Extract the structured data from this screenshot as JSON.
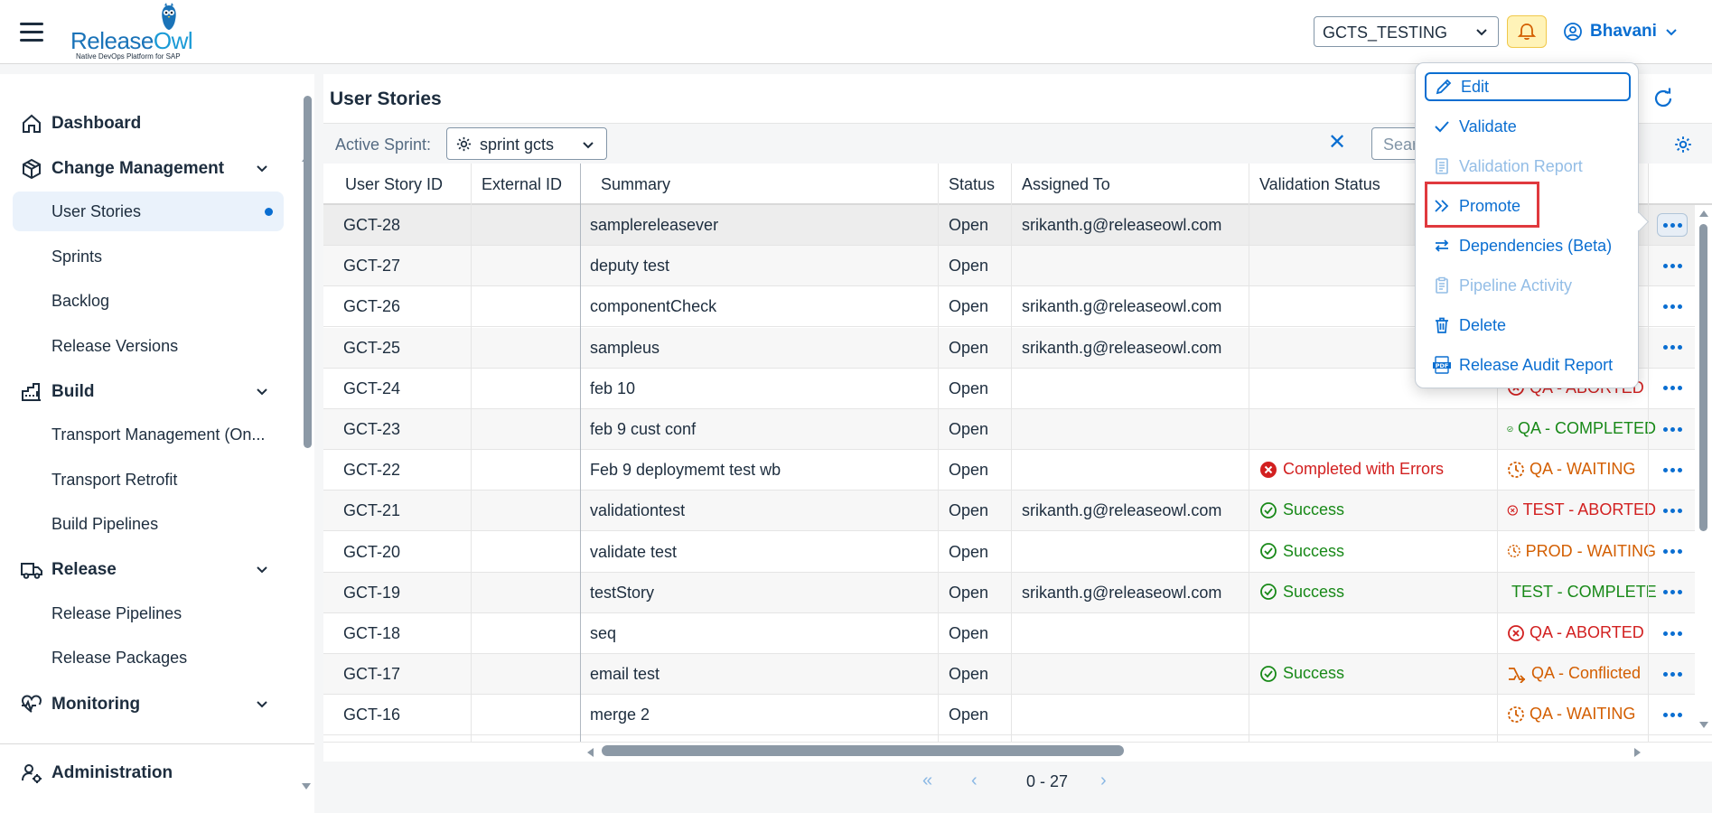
{
  "header": {
    "logo_main": "Release",
    "logo_accent": "Owl",
    "logo_sub": "Native DevOps Platform for SAP",
    "system_select": "GCTS_TESTING",
    "user_name": "Bhavani"
  },
  "sidebar": {
    "groups": [
      {
        "label": "Dashboard",
        "icon": "home-icon"
      },
      {
        "label": "Change Management",
        "icon": "box-icon"
      },
      {
        "label": "Build",
        "icon": "factory-icon"
      },
      {
        "label": "Release",
        "icon": "truck-icon"
      },
      {
        "label": "Monitoring",
        "icon": "heart-pulse-icon"
      },
      {
        "label": "Administration",
        "icon": "user-settings-icon"
      }
    ],
    "items": [
      {
        "label": "User Stories"
      },
      {
        "label": "Sprints"
      },
      {
        "label": "Backlog"
      },
      {
        "label": "Release Versions"
      },
      {
        "label": "Transport Management (On..."
      },
      {
        "label": "Transport Retrofit"
      },
      {
        "label": "Build Pipelines"
      },
      {
        "label": "Release Pipelines"
      },
      {
        "label": "Release Packages"
      }
    ]
  },
  "main": {
    "title": "User Stories",
    "sprint_label": "Active Sprint:",
    "sprint_value": "sprint gcts",
    "search_placeholder": "Search",
    "clear_symbol": "✕",
    "columns": [
      "User Story ID",
      "External ID",
      "Summary",
      "Status",
      "Assigned To",
      "Validation Status"
    ],
    "rows": [
      {
        "id": "GCT-28",
        "ext": "",
        "summary": "samplereleasever",
        "status": "Open",
        "assigned": "srikanth.g@releaseowl.com",
        "validation": "",
        "validation_type": "",
        "pipeline": "",
        "pipeline_type": ""
      },
      {
        "id": "GCT-27",
        "ext": "",
        "summary": "deputy test",
        "status": "Open",
        "assigned": "",
        "validation": "",
        "validation_type": "",
        "pipeline": "",
        "pipeline_type": ""
      },
      {
        "id": "GCT-26",
        "ext": "",
        "summary": "componentCheck",
        "status": "Open",
        "assigned": "srikanth.g@releaseowl.com",
        "validation": "",
        "validation_type": "",
        "pipeline": "",
        "pipeline_type": ""
      },
      {
        "id": "GCT-25",
        "ext": "",
        "summary": "sampleus",
        "status": "Open",
        "assigned": "srikanth.g@releaseowl.com",
        "validation": "",
        "validation_type": "",
        "pipeline": "",
        "pipeline_type": ""
      },
      {
        "id": "GCT-24",
        "ext": "",
        "summary": "feb 10",
        "status": "Open",
        "assigned": "",
        "validation": "",
        "validation_type": "",
        "pipeline": "QA - ABORTED",
        "pipeline_type": "aborted"
      },
      {
        "id": "GCT-23",
        "ext": "",
        "summary": "feb 9 cust conf",
        "status": "Open",
        "assigned": "",
        "validation": "",
        "validation_type": "",
        "pipeline": "QA - COMPLETED",
        "pipeline_type": "completed"
      },
      {
        "id": "GCT-22",
        "ext": "",
        "summary": "Feb 9 deploymemt test wb",
        "status": "Open",
        "assigned": "",
        "validation": "Completed with Errors",
        "validation_type": "error",
        "pipeline": "QA - WAITING",
        "pipeline_type": "waiting"
      },
      {
        "id": "GCT-21",
        "ext": "",
        "summary": "validationtest",
        "status": "Open",
        "assigned": "srikanth.g@releaseowl.com",
        "validation": "Success",
        "validation_type": "success",
        "pipeline": "TEST - ABORTED",
        "pipeline_type": "aborted"
      },
      {
        "id": "GCT-20",
        "ext": "",
        "summary": "validate test",
        "status": "Open",
        "assigned": "",
        "validation": "Success",
        "validation_type": "success",
        "pipeline": "PROD - WAITING",
        "pipeline_type": "waiting"
      },
      {
        "id": "GCT-19",
        "ext": "",
        "summary": "testStory",
        "status": "Open",
        "assigned": "srikanth.g@releaseowl.com",
        "validation": "Success",
        "validation_type": "success",
        "pipeline": "TEST - COMPLETED",
        "pipeline_type": "completed"
      },
      {
        "id": "GCT-18",
        "ext": "",
        "summary": "seq",
        "status": "Open",
        "assigned": "",
        "validation": "",
        "validation_type": "",
        "pipeline": "QA - ABORTED",
        "pipeline_type": "aborted"
      },
      {
        "id": "GCT-17",
        "ext": "",
        "summary": "email test",
        "status": "Open",
        "assigned": "",
        "validation": "Success",
        "validation_type": "success",
        "pipeline": "QA - Conflicted",
        "pipeline_type": "conflicted"
      },
      {
        "id": "GCT-16",
        "ext": "",
        "summary": "merge 2",
        "status": "Open",
        "assigned": "",
        "validation": "",
        "validation_type": "",
        "pipeline": "QA - WAITING",
        "pipeline_type": "waiting"
      }
    ],
    "pager": "0 - 27"
  },
  "menu": {
    "items": [
      {
        "label": "Edit",
        "icon": "pencil-icon",
        "disabled": false
      },
      {
        "label": "Validate",
        "icon": "checkmark-icon",
        "disabled": false
      },
      {
        "label": "Validation Report",
        "icon": "report-icon",
        "disabled": true
      },
      {
        "label": "Promote",
        "icon": "double-chevron-right-icon",
        "disabled": false
      },
      {
        "label": "Dependencies (Beta)",
        "icon": "swap-arrows-icon",
        "disabled": false
      },
      {
        "label": "Pipeline Activity",
        "icon": "clipboard-icon",
        "disabled": true
      },
      {
        "label": "Delete",
        "icon": "trash-icon",
        "disabled": false
      },
      {
        "label": "Release Audit Report",
        "icon": "pdf-icon",
        "disabled": false
      }
    ]
  },
  "colors": {
    "accent": "#0a6ed1",
    "success": "#188918",
    "error": "#d22020",
    "waiting": "#d35e00",
    "highlight": "#e0393e"
  }
}
